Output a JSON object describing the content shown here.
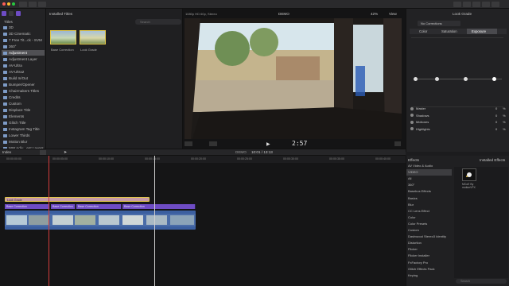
{
  "browser": {
    "category": "Installed Titles",
    "search_placeholder": "Search",
    "thumbs": [
      {
        "label": "Base Correction"
      },
      {
        "label": "Look Grade"
      }
    ]
  },
  "sidebar": {
    "header": "Titles",
    "items": [
      {
        "label": "3D"
      },
      {
        "label": "3D Cinematic"
      },
      {
        "label": "7 Free Tit...ck - SVM"
      },
      {
        "label": "360°"
      },
      {
        "label": "Adjustment",
        "selected": true
      },
      {
        "label": "Adjustment Layer"
      },
      {
        "label": "AV-Ultra"
      },
      {
        "label": "AV-Ultra2"
      },
      {
        "label": "Build In/Out"
      },
      {
        "label": "Bumper/Opener"
      },
      {
        "label": "Chairmakers Titles"
      },
      {
        "label": "Credits"
      },
      {
        "label": "Custom"
      },
      {
        "label": "Displace Title"
      },
      {
        "label": "Elements"
      },
      {
        "label": "Glitch Title"
      },
      {
        "label": "Instagram Tag Title"
      },
      {
        "label": "Lower Thirds"
      },
      {
        "label": "Motion Blur"
      },
      {
        "label": "MW Adju...ent Layers"
      }
    ]
  },
  "viewer": {
    "format": "1080p HD 60p, Stereo",
    "project": "DEMO",
    "zoom": "42%",
    "view_label": "View",
    "timecode": "2:57"
  },
  "inspector": {
    "title": "Look Grade",
    "corrections_dropdown": "No Corrections",
    "tabs": [
      "Color",
      "Saturation",
      "Exposure"
    ],
    "active_tab": "Exposure",
    "rows": [
      {
        "label": "Master",
        "value": "0"
      },
      {
        "label": "Shadows",
        "value": "0"
      },
      {
        "label": "Midtones",
        "value": "0"
      },
      {
        "label": "Highlights",
        "value": "0"
      }
    ],
    "unit": "%"
  },
  "timeline": {
    "index_label": "Index",
    "project": "DEMO",
    "timecode": "10:01 / 13:13",
    "ruler_ticks": [
      "00:00:00:00",
      "00:00:05:00",
      "00:00:10:00",
      "00:00:15:00",
      "00:00:20:00",
      "00:00:25:00",
      "00:00:30:00",
      "00:00:35:00",
      "00:00:40:00"
    ],
    "clips": {
      "look_grade": "Look Grade",
      "base_corrections": [
        "Base Correction",
        "Base Correction",
        "Base Correction",
        "Base Correction"
      ]
    }
  },
  "effects": {
    "header": "Effects",
    "installed_label": "Installed Effects",
    "categories": [
      {
        "label": "AV Video & Audio"
      },
      {
        "label": "VIDEO",
        "selected": true
      },
      {
        "label": "All"
      },
      {
        "label": "360°"
      },
      {
        "label": "Basebus Effects"
      },
      {
        "label": "Basics"
      },
      {
        "label": "Blur"
      },
      {
        "label": "CC Lens Effect"
      },
      {
        "label": "Color"
      },
      {
        "label": "Color Presets"
      },
      {
        "label": "Custom"
      },
      {
        "label": "Dashwood Stereo3 Identity"
      },
      {
        "label": "Distortion"
      },
      {
        "label": "Flicker"
      },
      {
        "label": "Flicker Installer"
      },
      {
        "label": "FxFactory Pro"
      },
      {
        "label": "Glitch Effects Pack"
      },
      {
        "label": "Keying"
      }
    ],
    "preview_label": "MCoE By motionVFX",
    "search_placeholder": "Search"
  },
  "colors": {
    "accent_purple": "#6e4cc4",
    "playhead_red": "#d33c3c",
    "selected_yellow": "#e0c64a",
    "adjustment_clip": "#c89aa6"
  }
}
